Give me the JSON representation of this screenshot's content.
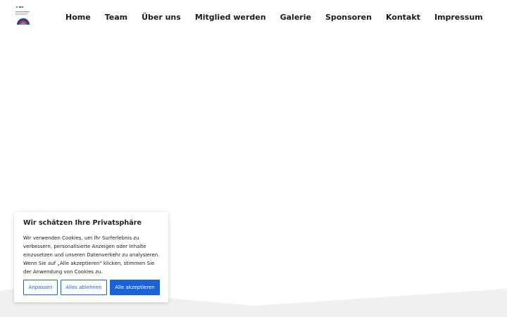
{
  "header": {
    "logo_icon": "club-logo-icon",
    "nav": [
      {
        "label": "Home"
      },
      {
        "label": "Team"
      },
      {
        "label": "Über uns"
      },
      {
        "label": "Mitglied werden"
      },
      {
        "label": "Galerie"
      },
      {
        "label": "Sponsoren"
      },
      {
        "label": "Kontakt"
      },
      {
        "label": "Impressum"
      }
    ]
  },
  "cookie_banner": {
    "title": "Wir schätzen Ihre Privatsphäre",
    "text": "Wir verwenden Cookies, um Ihr Surferlebnis zu verbessern, personalisierte Anzeigen oder Inhalte einzusetzen und unseren Datenverkehr zu analysieren. Wenn Sie auf „Alle akzeptieren\" klicken, stimmen Sie der Anwendung von Cookies zu.",
    "customize_label": "Anpassen",
    "reject_label": "Alles ablehnen",
    "accept_label": "Alle akzeptieren"
  },
  "colors": {
    "accent": "#1863dc",
    "text": "#1a1a1a",
    "wave": "#f0f0f0"
  }
}
